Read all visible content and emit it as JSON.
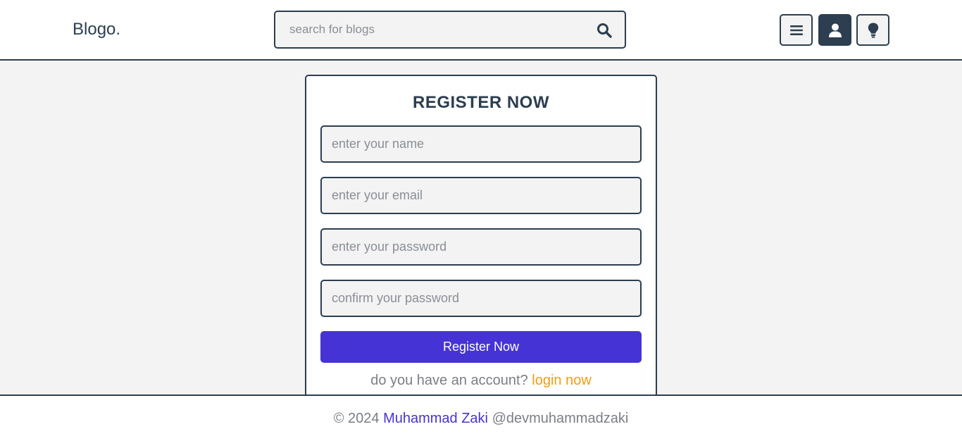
{
  "header": {
    "logo": "Blogo.",
    "search": {
      "placeholder": "search for blogs",
      "value": ""
    },
    "buttons": [
      {
        "icon": "menu-icon"
      },
      {
        "icon": "user-icon"
      },
      {
        "icon": "lightbulb-icon"
      }
    ]
  },
  "form": {
    "title": "REGISTER NOW",
    "fields": [
      {
        "placeholder": "enter your name"
      },
      {
        "placeholder": "enter your email"
      },
      {
        "placeholder": "enter your password"
      },
      {
        "placeholder": "confirm your password"
      }
    ],
    "submit_label": "Register Now",
    "switch_prompt": "do you have an account?",
    "switch_link": "login now"
  },
  "footer": {
    "copyright": "© 2024",
    "author": "Muhammad Zaki",
    "handle": "@devmuhammadzaki"
  },
  "colors": {
    "primary": "#2c3e50",
    "accent": "#4633d6",
    "link": "#f39c12",
    "background": "#f3f3f3"
  }
}
